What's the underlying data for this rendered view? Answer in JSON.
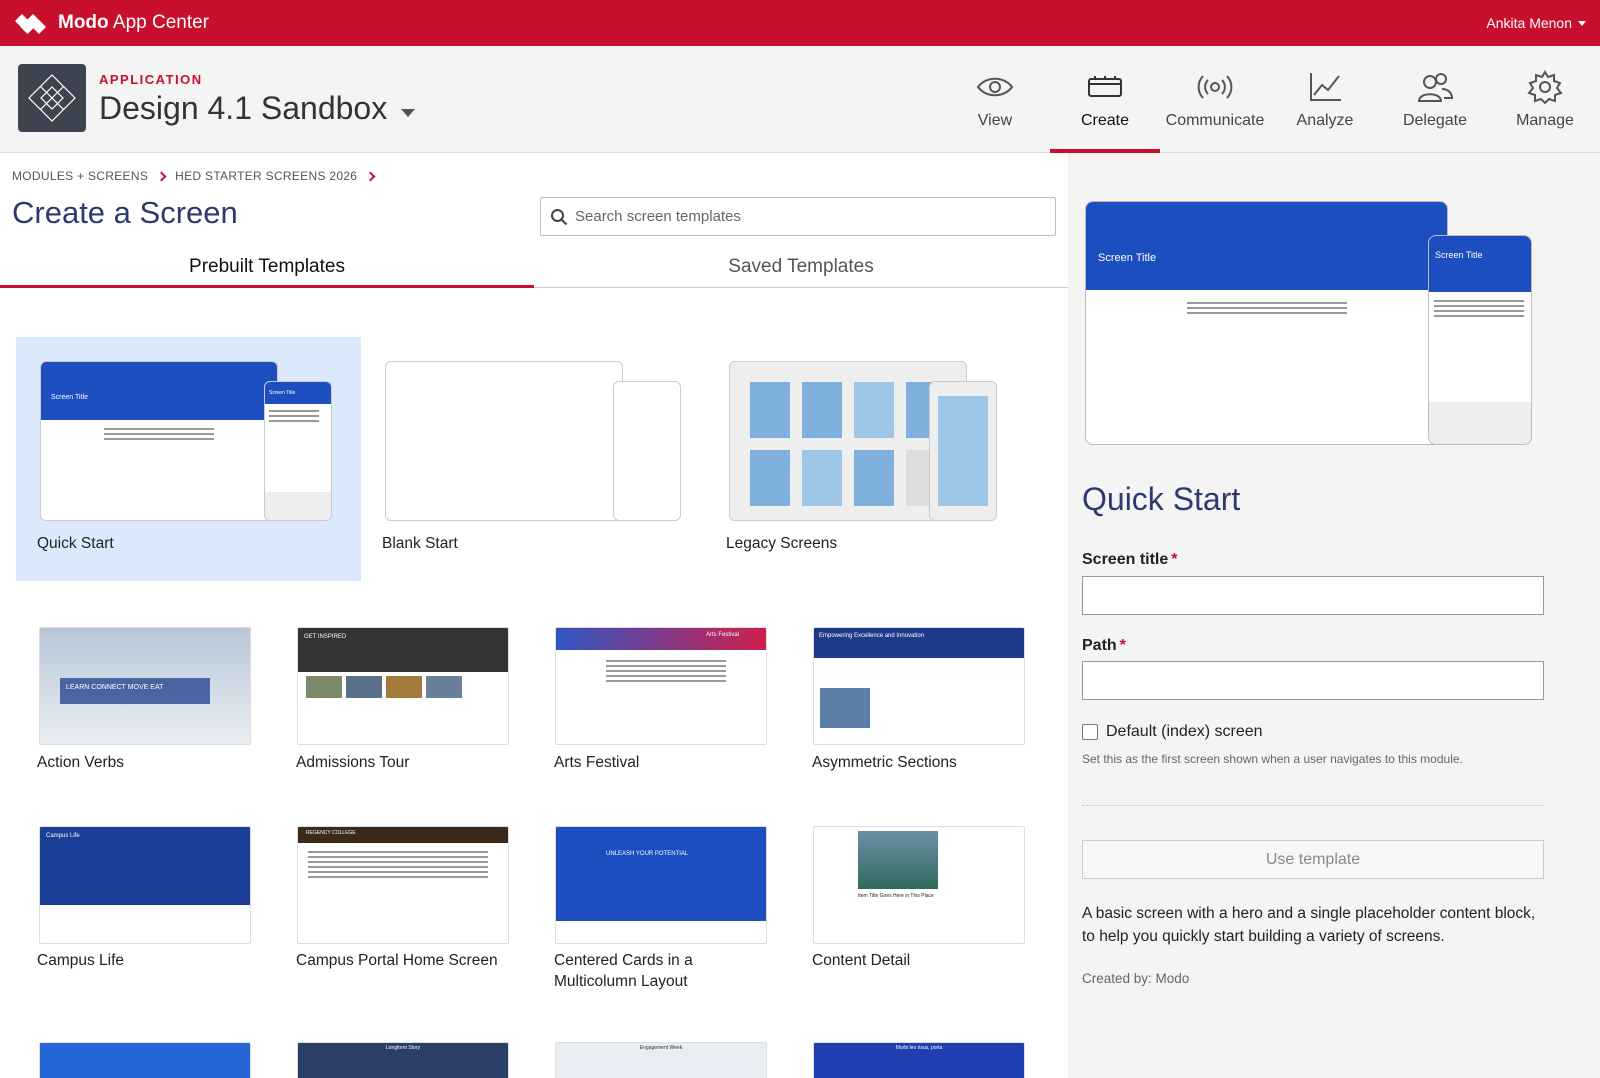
{
  "topbar": {
    "brand_bold": "Modo",
    "brand_rest": "App Center",
    "user": "Ankita Menon"
  },
  "app": {
    "kicker": "APPLICATION",
    "name": "Design 4.1 Sandbox"
  },
  "nav": [
    {
      "label": "View",
      "icon": "eye-icon"
    },
    {
      "label": "Create",
      "icon": "create-icon",
      "active": true
    },
    {
      "label": "Communicate",
      "icon": "broadcast-icon"
    },
    {
      "label": "Analyze",
      "icon": "chart-icon"
    },
    {
      "label": "Delegate",
      "icon": "users-icon"
    },
    {
      "label": "Manage",
      "icon": "gear-icon"
    }
  ],
  "breadcrumb": [
    "MODULES + SCREENS",
    "HED STARTER SCREENS 2026"
  ],
  "page_title": "Create a Screen",
  "search": {
    "placeholder": "Search screen templates"
  },
  "tabs": [
    "Prebuilt Templates",
    "Saved Templates"
  ],
  "starters": [
    {
      "label": "Quick Start",
      "selected": true,
      "hero_text": "Screen Title"
    },
    {
      "label": "Blank Start"
    },
    {
      "label": "Legacy Screens"
    }
  ],
  "templates": [
    {
      "label": "Action Verbs",
      "hero_text": "LEARN  CONNECT  MOVE  EAT"
    },
    {
      "label": "Admissions Tour",
      "hero_text": "GET INSPIRED"
    },
    {
      "label": "Arts Festival",
      "hero_text": "Arts Festival"
    },
    {
      "label": "Asymmetric Sections",
      "hero_text": "Empowering Excellence and Innovation"
    },
    {
      "label": "Campus Life",
      "hero_text": "Campus Life"
    },
    {
      "label": "Campus Portal Home Screen",
      "hero_text": "REGENCY COLLEGE"
    },
    {
      "label": "Centered Cards in a\nMulticolumn Layout",
      "label_line1": "Centered Cards in a",
      "label_line2": "Multicolumn Layout",
      "hero_text": "UNLEASH YOUR POTENTIAL"
    },
    {
      "label": "Content Detail",
      "hero_text": "Item Title Goes Here in This Place"
    }
  ],
  "bottom_row_hero": [
    "",
    "Longform Story",
    "Engagement Week",
    "Morbi leo risus, porta"
  ],
  "detail": {
    "preview_hero": "Screen Title",
    "title": "Quick Start",
    "screen_title_label": "Screen title",
    "path_label": "Path",
    "required_mark": "*",
    "default_check_label": "Default (index) screen",
    "default_help": "Set this as the first screen shown when a user navigates to this module.",
    "use_button": "Use template",
    "description": "A basic screen with a hero and a single placeholder content block, to help you quickly start building a variety of screens.",
    "created_by": "Created by: Modo"
  },
  "colors": {
    "brand_red": "#c8102e",
    "hero_blue": "#1d4ec0",
    "title_navy": "#2e3a6e",
    "selected_bg": "#dce8fb"
  }
}
